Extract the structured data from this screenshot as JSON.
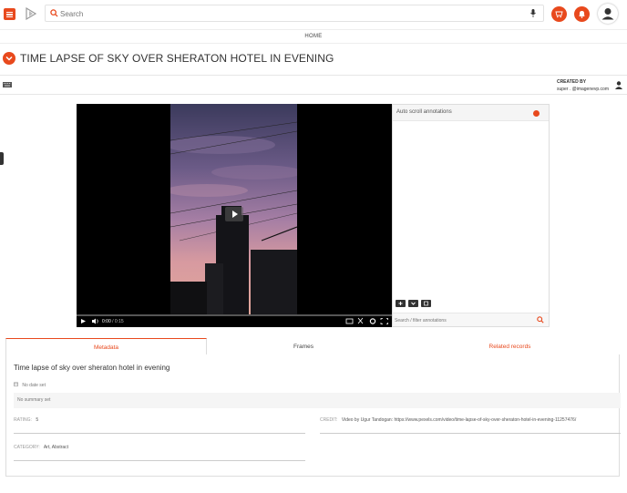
{
  "header": {
    "search_placeholder": "Search",
    "nav_home": "HOME",
    "icons": {
      "menu": "menu-icon",
      "logo": "play-logo-icon",
      "search": "search-icon",
      "mic": "mic-icon",
      "cart": "cart-icon",
      "bell": "bell-icon",
      "avatar": "user-avatar-icon"
    }
  },
  "page": {
    "title": "TIME LAPSE OF SKY OVER SHERATON HOTEL IN EVENING",
    "created_label": "CREATED BY",
    "created_value": "super . @imagenevp.com"
  },
  "player": {
    "time_current": "0:00",
    "time_total": "/ 0:15"
  },
  "annotations": {
    "heading": "Auto scroll annotations",
    "auto_scroll_on": true,
    "search_placeholder": "Search / filter annotations"
  },
  "tabs": {
    "metadata": "Metadata",
    "frames": "Frames",
    "related": "Related records"
  },
  "metadata": {
    "title": "Time lapse of sky over sheraton hotel in evening",
    "date": "No date set",
    "summary": "No summary set",
    "rating_label": "RATING:",
    "rating_value": "5",
    "credit_label": "CREDIT:",
    "credit_value": "Video by Ugur Tandogan: https://www.pexels.com/video/time-lapse-of-sky-over-sheraton-hotel-in-evening-11257476/",
    "category_label": "CATEGORY:",
    "category_value": "Art, Abstract"
  },
  "colors": {
    "accent": "#e8491d"
  }
}
